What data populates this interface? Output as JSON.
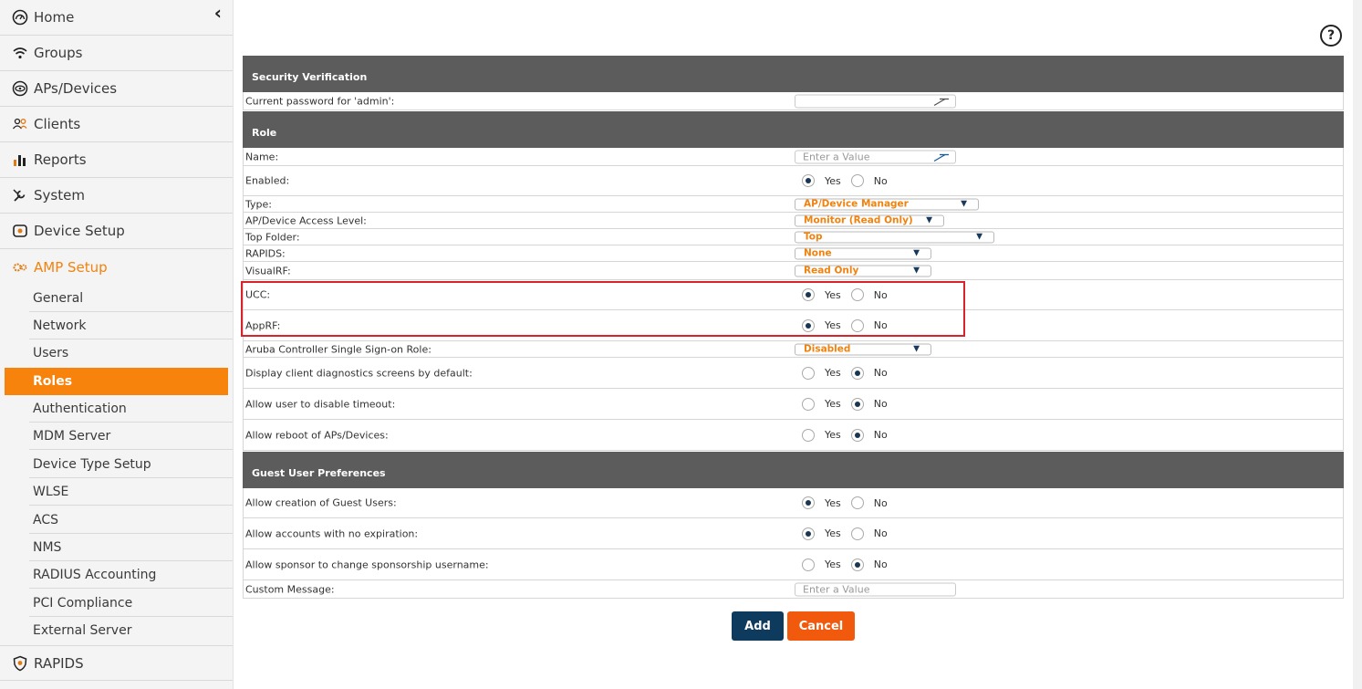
{
  "sidebar": {
    "collapse_glyph": "‹",
    "items": [
      {
        "label": "Home",
        "icon": "dashboard-icon"
      },
      {
        "label": "Groups",
        "icon": "wifi-icon"
      },
      {
        "label": "APs/Devices",
        "icon": "eye-icon"
      },
      {
        "label": "Clients",
        "icon": "users-icon"
      },
      {
        "label": "Reports",
        "icon": "bar-chart-icon"
      },
      {
        "label": "System",
        "icon": "wrench-icon"
      },
      {
        "label": "Device Setup",
        "icon": "router-icon"
      },
      {
        "label": "AMP Setup",
        "icon": "gears-icon"
      }
    ],
    "sub_items": [
      "General",
      "Network",
      "Users",
      "Roles",
      "Authentication",
      "MDM Server",
      "Device Type Setup",
      "WLSE",
      "ACS",
      "NMS",
      "RADIUS Accounting",
      "PCI Compliance",
      "External Server"
    ],
    "active_sub": "Roles",
    "bottom_item": {
      "label": "RAPIDS",
      "icon": "shield-icon"
    }
  },
  "help_glyph": "?",
  "sections": {
    "security": "Security Verification",
    "role": "Role",
    "guest": "Guest User Preferences"
  },
  "fields": {
    "current_password": {
      "label": "Current password for 'admin':",
      "placeholder": ""
    },
    "name": {
      "label": "Name:",
      "placeholder": "Enter a Value"
    },
    "enabled": {
      "label": "Enabled:",
      "value": "Yes"
    },
    "type": {
      "label": "Type:",
      "value": "AP/Device Manager"
    },
    "access_level": {
      "label": "AP/Device Access Level:",
      "value": "Monitor (Read Only)"
    },
    "top_folder": {
      "label": "Top Folder:",
      "value": "Top"
    },
    "rapids": {
      "label": "RAPIDS:",
      "value": "None"
    },
    "visualrf": {
      "label": "VisualRF:",
      "value": "Read Only"
    },
    "ucc": {
      "label": "UCC:",
      "value": "Yes"
    },
    "apprf": {
      "label": "AppRF:",
      "value": "Yes"
    },
    "sso_role": {
      "label": "Aruba Controller Single Sign-on Role:",
      "value": "Disabled"
    },
    "client_diag": {
      "label": "Display client diagnostics screens by default:",
      "value": "No"
    },
    "disable_timeout": {
      "label": "Allow user to disable timeout:",
      "value": "No"
    },
    "reboot": {
      "label": "Allow reboot of APs/Devices:",
      "value": "No"
    },
    "guest_create": {
      "label": "Allow creation of Guest Users:",
      "value": "Yes"
    },
    "no_expiration": {
      "label": "Allow accounts with no expiration:",
      "value": "Yes"
    },
    "sponsor_change": {
      "label": "Allow sponsor to change sponsorship username:",
      "value": "No"
    },
    "custom_message": {
      "label": "Custom Message:",
      "placeholder": "Enter a Value"
    }
  },
  "radio_labels": {
    "yes": "Yes",
    "no": "No"
  },
  "buttons": {
    "add": "Add",
    "cancel": "Cancel"
  },
  "colors": {
    "accent": "#f7830d",
    "header": "#5c5c5c",
    "add": "#0e3a5e",
    "cancel": "#f15a0c",
    "highlight": "#d9232a"
  }
}
